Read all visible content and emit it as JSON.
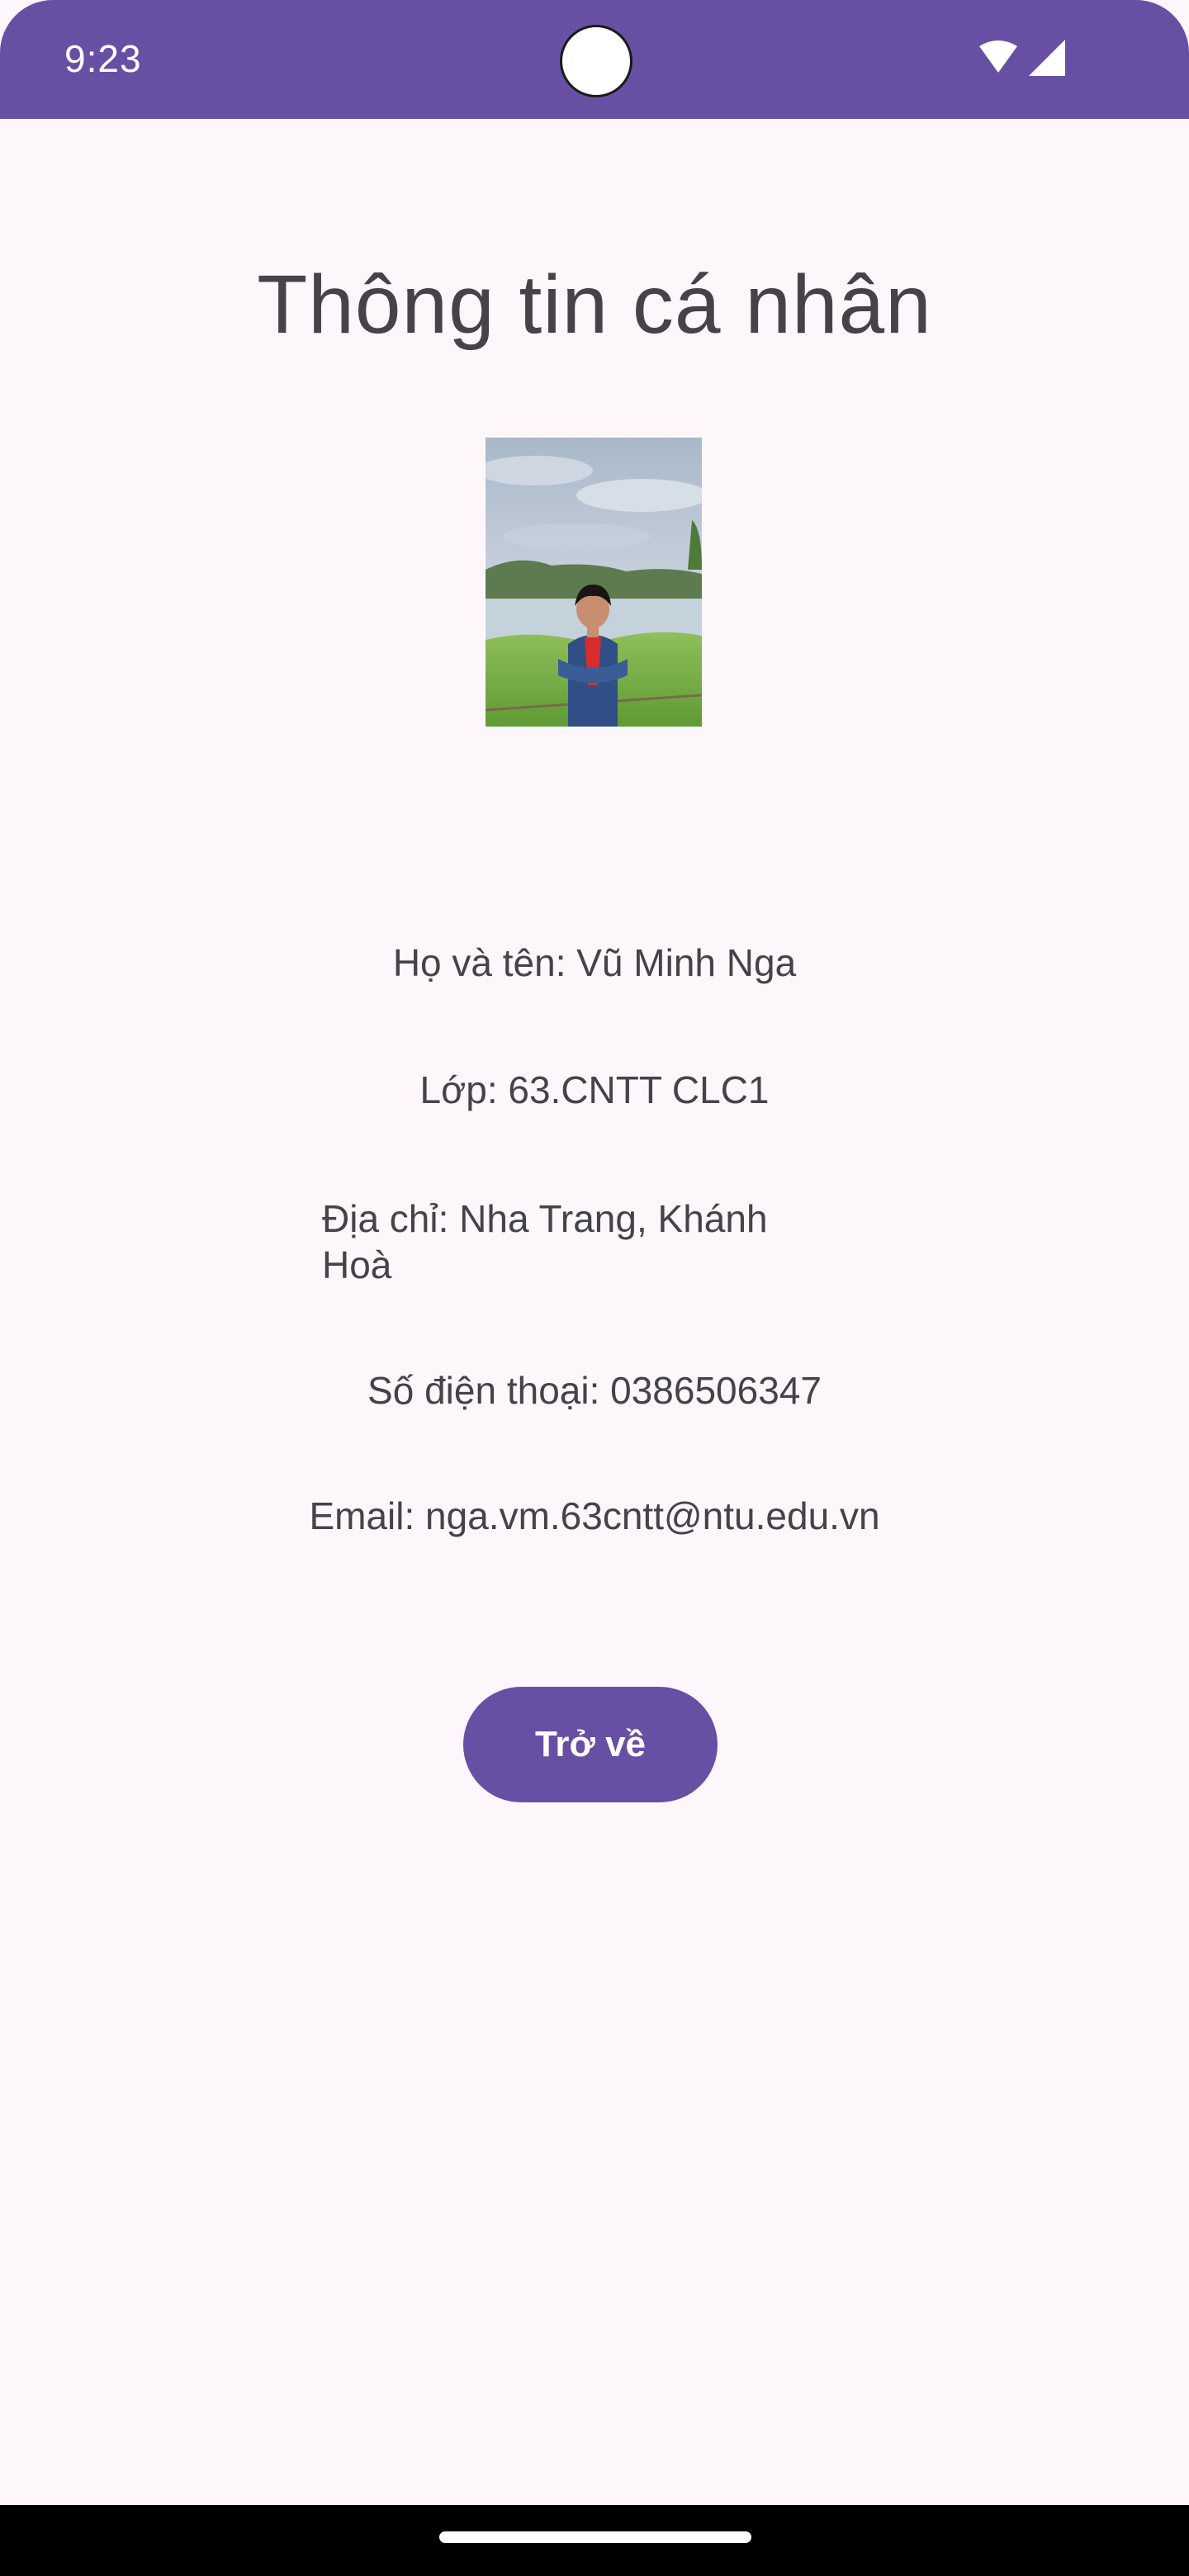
{
  "status_bar": {
    "time": "9:23",
    "icons": [
      "wifi-icon",
      "cellular-signal-icon"
    ],
    "background": "#6750a4"
  },
  "page": {
    "title": "Thông tin cá nhân"
  },
  "profile": {
    "name_line": "Họ và tên: Vũ Minh Nga",
    "class_line": "Lớp: 63.CNTT CLC1",
    "address_line": "Địa chỉ: Nha Trang, Khánh Hoà",
    "phone_line": "Số điện thoại: 0386506347",
    "email_line": "Email: nga.vm.63cntt@ntu.edu.vn"
  },
  "actions": {
    "back_label": "Trở về"
  },
  "colors": {
    "accent": "#6750a4",
    "surface": "#fdf7fc",
    "text": "#45424a"
  }
}
